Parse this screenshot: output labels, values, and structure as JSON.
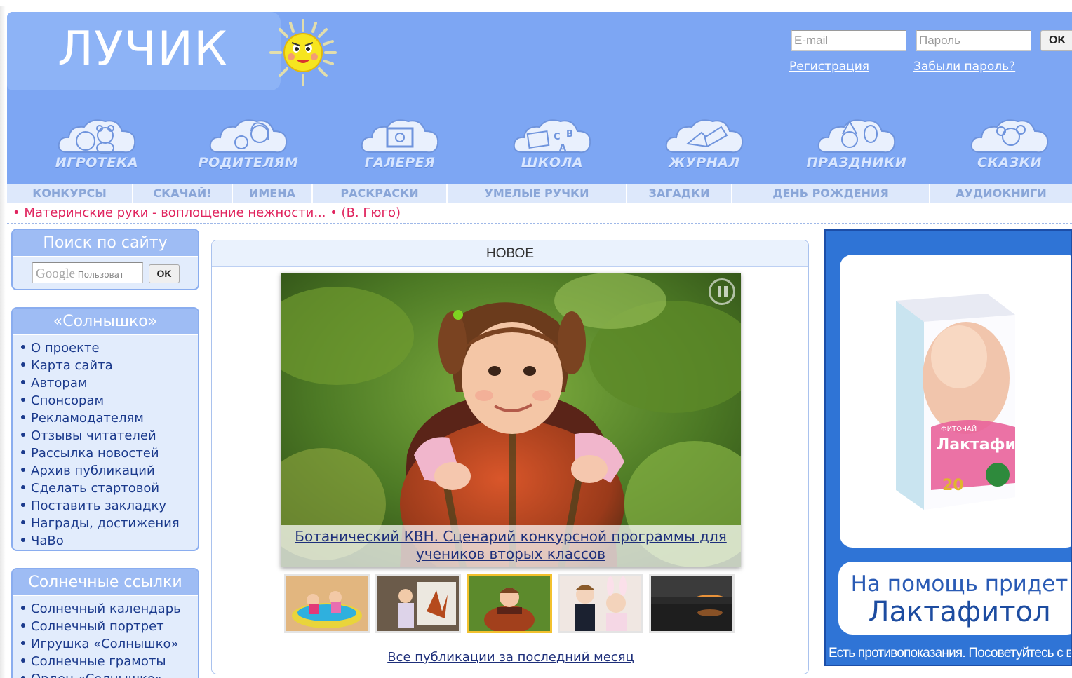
{
  "header": {
    "logo": "ЛУЧИК",
    "email_placeholder": "E-mail",
    "password_placeholder": "Пароль",
    "ok_label": "OK",
    "register_link": "Регистрация",
    "forgot_link": "Забыли пароль?"
  },
  "main_nav": [
    {
      "label": "ИГРОТЕКА",
      "icon": "teddy-bear-icon"
    },
    {
      "label": "РОДИТЕЛЯМ",
      "icon": "family-icon"
    },
    {
      "label": "ГАЛЕРЕЯ",
      "icon": "picture-frame-icon"
    },
    {
      "label": "ШКОЛА",
      "icon": "abc-blocks-icon"
    },
    {
      "label": "ЖУРНАЛ",
      "icon": "open-book-icon"
    },
    {
      "label": "ПРАЗДНИКИ",
      "icon": "party-icon"
    },
    {
      "label": "СКАЗКИ",
      "icon": "fairy-tale-icon"
    }
  ],
  "sub_nav": [
    "КОНКУРСЫ",
    "СКАЧАЙ!",
    "ИМЕНА",
    "РАСКРАСКИ",
    "УМЕЛЫЕ РУЧКИ",
    "ЗАГАДКИ",
    "ДЕНЬ РОЖДЕНИЯ",
    "АУДИОКНИГИ"
  ],
  "quote": "• Материнские руки - воплощение нежности... • (В. Гюго)",
  "search_box": {
    "title": "Поиск по сайту",
    "google_text": "Google",
    "placeholder": "Пользоват",
    "ok_label": "OK"
  },
  "sunshine_box": {
    "title": "«Солнышко»",
    "items": [
      "О проекте",
      "Карта сайта",
      "Авторам",
      "Спонсорам",
      "Рекламодателям",
      "Отзывы читателей",
      "Рассылка новостей",
      "Архив публикаций",
      "Сделать стартовой",
      "Поставить закладку",
      "Награды, достижения",
      "ЧаВо"
    ]
  },
  "links_box": {
    "title": "Солнечные ссылки",
    "items": [
      "Солнечный календарь",
      "Солнечный портрет",
      "Игрушка «Солнышко»",
      "Солнечные грамоты",
      "Орден «Солнышко»"
    ]
  },
  "new_section": {
    "title": "НОВОЕ",
    "caption_line1": "Ботанический КВН. Сценарий конкурсной программы для",
    "caption_line2": "учеников вторых классов",
    "all_link": "Все публикации за последний месяц",
    "active_thumb": 2
  },
  "ad": {
    "line1": "На помощь придет",
    "line2": "Лактафитол",
    "disclaimer": "Есть противопоказания. Посоветуйтесь с врачом",
    "box_brand": "Лактафитол",
    "box_label": "ФИТОЧАЙ",
    "box_count": "20"
  },
  "colors": {
    "header_bg": "#7da6f3",
    "subnav_bg": "#dde8fb",
    "quote": "#e0245e",
    "link": "#1e2f7a",
    "ad_bg": "#2f74d6"
  }
}
